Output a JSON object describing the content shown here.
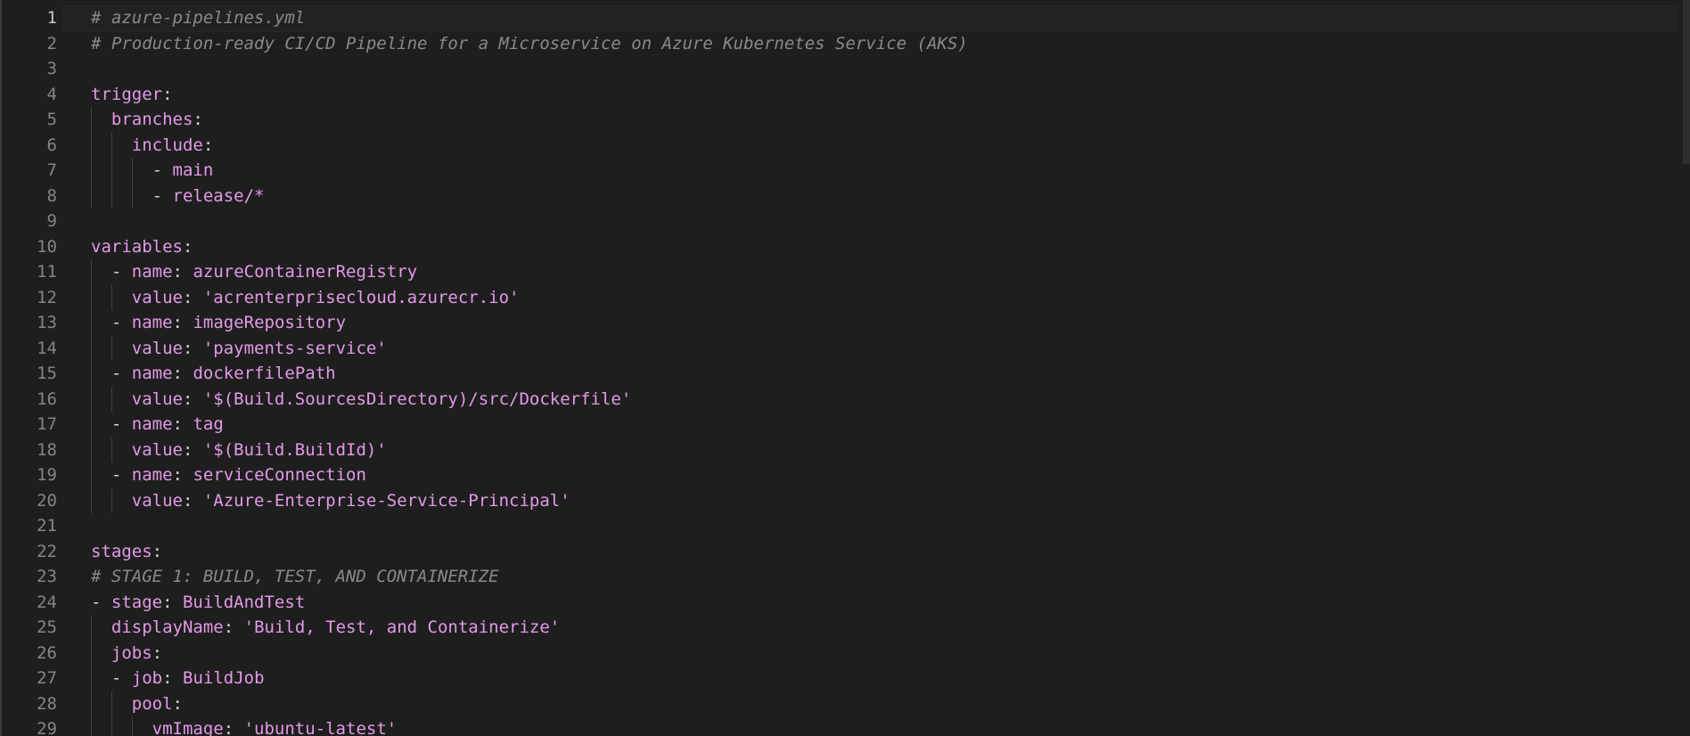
{
  "editor": {
    "file_comment": "# azure-pipelines.yml",
    "active_line": 1,
    "lines": [
      {
        "n": "1",
        "tokens": [
          [
            "c",
            "# azure-pipelines.yml"
          ]
        ]
      },
      {
        "n": "2",
        "tokens": [
          [
            "c",
            "# Production-ready CI/CD Pipeline for a Microservice on Azure Kubernetes Service (AKS)"
          ]
        ]
      },
      {
        "n": "3",
        "tokens": []
      },
      {
        "n": "4",
        "tokens": [
          [
            "k",
            "trigger"
          ],
          [
            "p",
            ":"
          ]
        ]
      },
      {
        "n": "5",
        "tokens": [
          [
            "s",
            "  "
          ],
          [
            "k",
            "branches"
          ],
          [
            "p",
            ":"
          ]
        ]
      },
      {
        "n": "6",
        "tokens": [
          [
            "s",
            "    "
          ],
          [
            "k",
            "include"
          ],
          [
            "p",
            ":"
          ]
        ]
      },
      {
        "n": "7",
        "tokens": [
          [
            "s",
            "      "
          ],
          [
            "p",
            "- "
          ],
          [
            "v",
            "main"
          ]
        ]
      },
      {
        "n": "8",
        "tokens": [
          [
            "s",
            "      "
          ],
          [
            "p",
            "- "
          ],
          [
            "v",
            "release/*"
          ]
        ]
      },
      {
        "n": "9",
        "tokens": []
      },
      {
        "n": "10",
        "tokens": [
          [
            "k",
            "variables"
          ],
          [
            "p",
            ":"
          ]
        ]
      },
      {
        "n": "11",
        "tokens": [
          [
            "s",
            "  "
          ],
          [
            "p",
            "- "
          ],
          [
            "k",
            "name"
          ],
          [
            "p",
            ": "
          ],
          [
            "v",
            "azureContainerRegistry"
          ]
        ]
      },
      {
        "n": "12",
        "tokens": [
          [
            "s",
            "    "
          ],
          [
            "k",
            "value"
          ],
          [
            "p",
            ": "
          ],
          [
            "v",
            "'acrenterprisecloud.azurecr.io'"
          ]
        ]
      },
      {
        "n": "13",
        "tokens": [
          [
            "s",
            "  "
          ],
          [
            "p",
            "- "
          ],
          [
            "k",
            "name"
          ],
          [
            "p",
            ": "
          ],
          [
            "v",
            "imageRepository"
          ]
        ]
      },
      {
        "n": "14",
        "tokens": [
          [
            "s",
            "    "
          ],
          [
            "k",
            "value"
          ],
          [
            "p",
            ": "
          ],
          [
            "v",
            "'payments-service'"
          ]
        ]
      },
      {
        "n": "15",
        "tokens": [
          [
            "s",
            "  "
          ],
          [
            "p",
            "- "
          ],
          [
            "k",
            "name"
          ],
          [
            "p",
            ": "
          ],
          [
            "v",
            "dockerfilePath"
          ]
        ]
      },
      {
        "n": "16",
        "tokens": [
          [
            "s",
            "    "
          ],
          [
            "k",
            "value"
          ],
          [
            "p",
            ": "
          ],
          [
            "v",
            "'$(Build.SourcesDirectory)/src/Dockerfile'"
          ]
        ]
      },
      {
        "n": "17",
        "tokens": [
          [
            "s",
            "  "
          ],
          [
            "p",
            "- "
          ],
          [
            "k",
            "name"
          ],
          [
            "p",
            ": "
          ],
          [
            "v",
            "tag"
          ]
        ]
      },
      {
        "n": "18",
        "tokens": [
          [
            "s",
            "    "
          ],
          [
            "k",
            "value"
          ],
          [
            "p",
            ": "
          ],
          [
            "v",
            "'$(Build.BuildId)'"
          ]
        ]
      },
      {
        "n": "19",
        "tokens": [
          [
            "s",
            "  "
          ],
          [
            "p",
            "- "
          ],
          [
            "k",
            "name"
          ],
          [
            "p",
            ": "
          ],
          [
            "v",
            "serviceConnection"
          ]
        ]
      },
      {
        "n": "20",
        "tokens": [
          [
            "s",
            "    "
          ],
          [
            "k",
            "value"
          ],
          [
            "p",
            ": "
          ],
          [
            "v",
            "'Azure-Enterprise-Service-Principal'"
          ]
        ]
      },
      {
        "n": "21",
        "tokens": []
      },
      {
        "n": "22",
        "tokens": [
          [
            "k",
            "stages"
          ],
          [
            "p",
            ":"
          ]
        ]
      },
      {
        "n": "23",
        "tokens": [
          [
            "c",
            "# STAGE 1: BUILD, TEST, AND CONTAINERIZE"
          ]
        ]
      },
      {
        "n": "24",
        "tokens": [
          [
            "p",
            "- "
          ],
          [
            "k",
            "stage"
          ],
          [
            "p",
            ": "
          ],
          [
            "v",
            "BuildAndTest"
          ]
        ]
      },
      {
        "n": "25",
        "tokens": [
          [
            "s",
            "  "
          ],
          [
            "k",
            "displayName"
          ],
          [
            "p",
            ": "
          ],
          [
            "v",
            "'Build, Test, and Containerize'"
          ]
        ]
      },
      {
        "n": "26",
        "tokens": [
          [
            "s",
            "  "
          ],
          [
            "k",
            "jobs"
          ],
          [
            "p",
            ":"
          ]
        ]
      },
      {
        "n": "27",
        "tokens": [
          [
            "s",
            "  "
          ],
          [
            "p",
            "- "
          ],
          [
            "k",
            "job"
          ],
          [
            "p",
            ": "
          ],
          [
            "v",
            "BuildJob"
          ]
        ]
      },
      {
        "n": "28",
        "tokens": [
          [
            "s",
            "    "
          ],
          [
            "k",
            "pool"
          ],
          [
            "p",
            ":"
          ]
        ]
      },
      {
        "n": "29",
        "tokens": [
          [
            "s",
            "      "
          ],
          [
            "k",
            "vmImage"
          ],
          [
            "p",
            ": "
          ],
          [
            "v",
            "'ubuntu-latest'"
          ]
        ]
      }
    ]
  }
}
